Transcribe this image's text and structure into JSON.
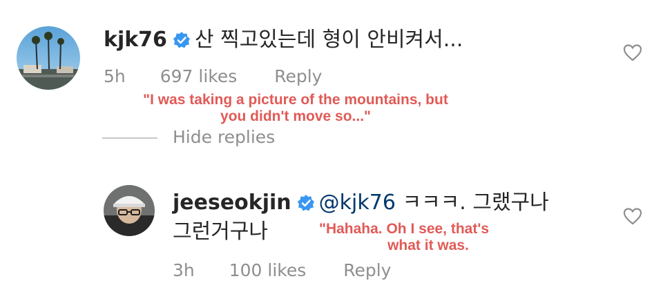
{
  "comment1": {
    "username": "kjk76",
    "text": "산 찍고있는데 형이 안비켜서...",
    "time": "5h",
    "likes": "697 likes",
    "reply": "Reply",
    "translation_line1": "\"I was taking a picture of the mountains, but",
    "translation_line2": "you didn't move so...\""
  },
  "thread": {
    "hide_replies": "Hide replies"
  },
  "comment2": {
    "username": "jeeseokjin",
    "mention": "@kjk76",
    "text_line1": "ㅋㅋㅋ. 그랬구나",
    "text_line2": "그런거구나",
    "time": "3h",
    "likes": "100 likes",
    "reply": "Reply",
    "translation_line1": "\"Hahaha. Oh I see, that's",
    "translation_line2": "what it was."
  },
  "colors": {
    "verified": "#3897f0",
    "translation": "#e05a56",
    "meta": "#8e8e8e",
    "mention": "#00376b"
  },
  "icons": [
    "verified-badge-icon",
    "heart-icon"
  ]
}
